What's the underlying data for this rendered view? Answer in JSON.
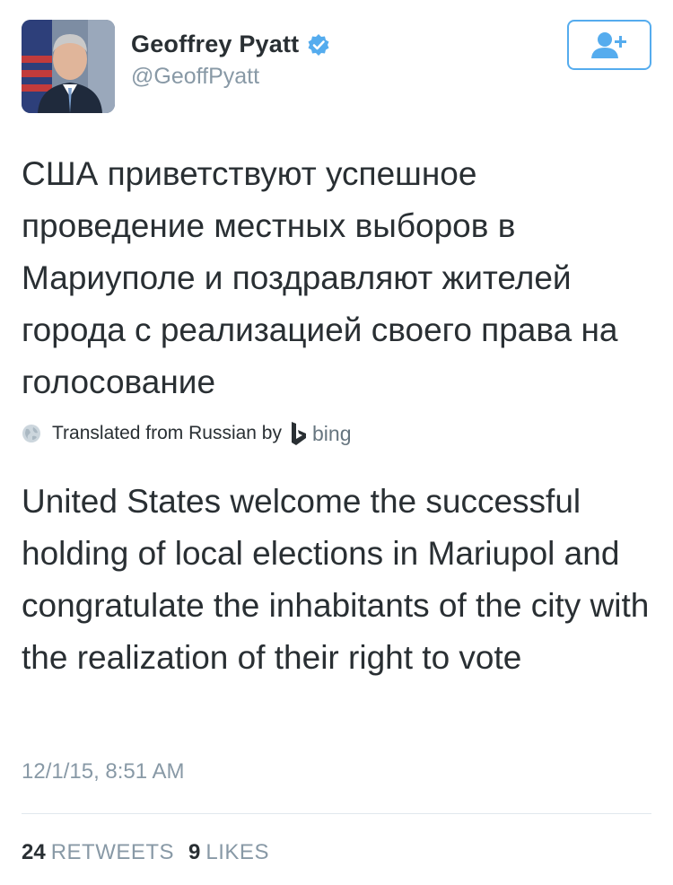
{
  "profile": {
    "display_name": "Geoffrey Pyatt",
    "handle": "@GeoffPyatt",
    "verified_icon": "verified-badge-icon",
    "follow_icon": "add-user-icon"
  },
  "tweet": {
    "original_text": "США приветствуют успешное проведение местных выборов в Мариуполе и поздравляют жителей города с реализацией своего права на голосование",
    "translation_label": "Translated from Russian by",
    "translation_provider": "bing",
    "translated_text": "United States welcome the successful holding of local elections in Mariupol and congratulate the inhabitants of the city with the realization of their right to vote",
    "timestamp": "12/1/15, 8:51 AM"
  },
  "stats": {
    "retweets_count": "24",
    "retweets_label": "RETWEETS",
    "likes_count": "9",
    "likes_label": "LIKES"
  },
  "colors": {
    "accent": "#55acee",
    "text": "#292f33",
    "muted": "#8899a6"
  }
}
